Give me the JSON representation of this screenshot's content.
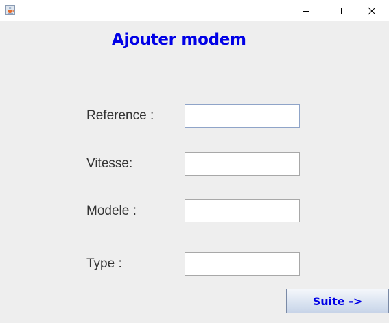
{
  "window": {
    "icon": "java-cup-icon",
    "controls": {
      "minimize_icon": "minimize-icon",
      "maximize_icon": "maximize-icon",
      "close_icon": "close-icon"
    }
  },
  "form": {
    "title": "Ajouter modem",
    "fields": [
      {
        "label": "Reference :",
        "value": ""
      },
      {
        "label": "Vitesse:",
        "value": ""
      },
      {
        "label": "Modele :",
        "value": ""
      },
      {
        "label": "Type :",
        "value": ""
      }
    ],
    "submit_label": "Suite ->"
  },
  "colors": {
    "title": "#0000e6",
    "button_text": "#0000e6",
    "background": "#eeeeee"
  }
}
